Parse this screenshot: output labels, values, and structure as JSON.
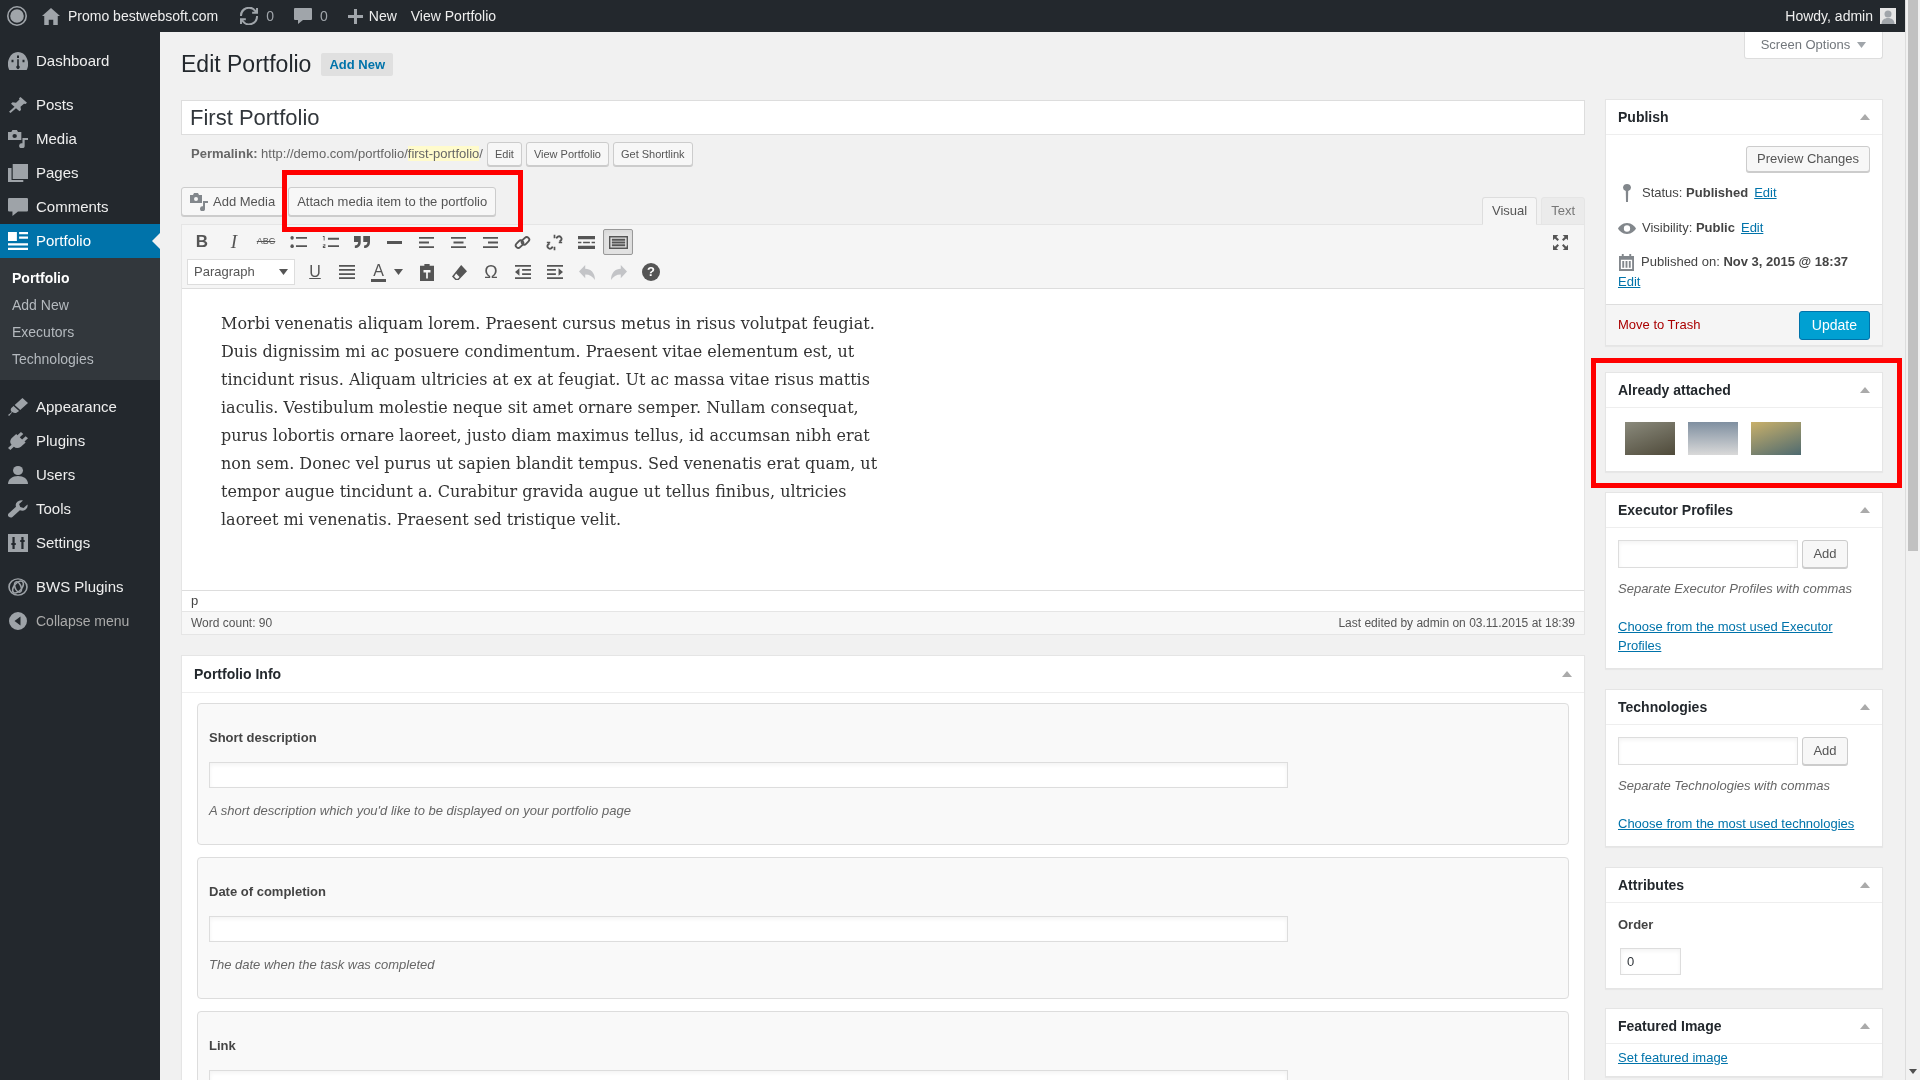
{
  "admin_bar": {
    "site_name": "Promo bestwebsoft.com",
    "updates": "0",
    "comments": "0",
    "new_label": "New",
    "view_label": "View Portfolio",
    "greeting": "Howdy, admin"
  },
  "sidebar": {
    "sections": [
      {
        "items": [
          {
            "kind": "dashboard",
            "label": "Dashboard",
            "selected": false
          }
        ]
      },
      {
        "items": [
          {
            "kind": "posts",
            "label": "Posts",
            "selected": false
          },
          {
            "kind": "media",
            "label": "Media",
            "selected": false
          },
          {
            "kind": "pages",
            "label": "Pages",
            "selected": false
          },
          {
            "kind": "comments",
            "label": "Comments",
            "selected": false
          },
          {
            "kind": "portfolio",
            "label": "Portfolio",
            "selected": true,
            "children": [
              {
                "label": "Portfolio",
                "selected": true
              },
              {
                "label": "Add New",
                "selected": false
              },
              {
                "label": "Executors",
                "selected": false
              },
              {
                "label": "Technologies",
                "selected": false
              }
            ]
          }
        ]
      },
      {
        "items": [
          {
            "kind": "appearance",
            "label": "Appearance",
            "selected": false
          },
          {
            "kind": "plugins",
            "label": "Plugins",
            "selected": false
          },
          {
            "kind": "users",
            "label": "Users",
            "selected": false
          },
          {
            "kind": "tools",
            "label": "Tools",
            "selected": false
          },
          {
            "kind": "settings",
            "label": "Settings",
            "selected": false
          }
        ]
      },
      {
        "items": [
          {
            "kind": "bws",
            "label": "BWS Plugins",
            "selected": false
          }
        ]
      }
    ],
    "collapse_label": "Collapse menu"
  },
  "screen_options": "Screen Options",
  "heading": {
    "title": "Edit Portfolio",
    "add_new": "Add New"
  },
  "post_title": "First Portfolio",
  "permalink": {
    "text": "**Permalink:** http://demo.com/portfolio/",
    "slug": "first-portfolio",
    "suffix": "/",
    "buttons": [
      "Edit",
      "View Portfolio",
      "Get Shortlink"
    ]
  },
  "media_buttons": [
    {
      "kind": "media",
      "label": "Add Media",
      "highlighted": false
    },
    {
      "kind": "attach",
      "label": "Attach media item to the portfolio",
      "highlighted": true
    }
  ],
  "editor_tabs": [
    {
      "label": "Visual",
      "selected": true
    },
    {
      "label": "Text",
      "selected": false
    }
  ],
  "toolbar": [
    [
      {
        "kind": "bold",
        "label": "B",
        "pressed": false,
        "disabled": false
      },
      {
        "kind": "italic",
        "label": "I",
        "pressed": false,
        "disabled": false
      },
      {
        "kind": "strike",
        "label": "ABC",
        "pressed": false,
        "disabled": false
      },
      {
        "kind": "bullets",
        "pressed": false,
        "disabled": false
      },
      {
        "kind": "numbers",
        "pressed": false,
        "disabled": false
      },
      {
        "kind": "quote",
        "pressed": false,
        "disabled": false
      },
      {
        "kind": "rule",
        "pressed": false,
        "disabled": false
      },
      {
        "kind": "alignleft",
        "pressed": false,
        "disabled": false
      },
      {
        "kind": "aligncenter",
        "pressed": false,
        "disabled": false
      },
      {
        "kind": "alignright",
        "pressed": false,
        "disabled": false
      },
      {
        "kind": "link",
        "pressed": false,
        "disabled": false
      },
      {
        "kind": "unlink",
        "pressed": false,
        "disabled": false
      },
      {
        "kind": "more",
        "pressed": false,
        "disabled": false
      },
      {
        "kind": "toggle",
        "pressed": true,
        "disabled": false
      },
      {
        "kind": "fullscreen",
        "pressed": false,
        "disabled": false
      }
    ],
    [
      {
        "kind": "format",
        "label": "Paragraph",
        "pressed": false,
        "disabled": false
      },
      {
        "kind": "underline",
        "label": "U",
        "pressed": false,
        "disabled": false
      },
      {
        "kind": "justify",
        "pressed": false,
        "disabled": false
      },
      {
        "kind": "color",
        "label": "A",
        "pressed": false,
        "disabled": false
      },
      {
        "kind": "paste",
        "pressed": false,
        "disabled": false
      },
      {
        "kind": "eraser",
        "pressed": false,
        "disabled": false
      },
      {
        "kind": "omega",
        "label": "Ω",
        "pressed": false,
        "disabled": false
      },
      {
        "kind": "outdent",
        "pressed": false,
        "disabled": false
      },
      {
        "kind": "indent",
        "pressed": false,
        "disabled": false
      },
      {
        "kind": "undo",
        "pressed": false,
        "disabled": true
      },
      {
        "kind": "redo",
        "pressed": false,
        "disabled": true
      },
      {
        "kind": "help",
        "label": "?",
        "pressed": false,
        "disabled": false
      }
    ]
  ],
  "content": "Morbi venenatis aliquam lorem. Praesent cursus metus in risus volutpat feugiat. Duis dignissim mi ac posuere condimentum. Praesent vitae elementum est, ut tincidunt risus. Aliquam ultricies at ex at feugiat. Ut ac massa vitae risus mattis iaculis. Vestibulum molestie neque sit amet ornare semper. Nullam consequat, purus lobortis ornare laoreet, justo diam maximus tellus, id accumsan nibh erat non sem. Donec vel purus ut sapien blandit tempus. Sed venenatis erat quam, ut tempor augue tincidunt a. Curabitur gravida augue ut tellus finibus, ultricies laoreet mi venenatis. Praesent sed tristique velit.",
  "path": "p",
  "word_count": "Word count: 90",
  "last_edited": "Last edited by admin on 03.11.2015 at 18:39",
  "portfolio_info": {
    "title": "Portfolio Info",
    "fields": [
      {
        "label": "Short description",
        "hint": "A short description which you'd like to be displayed on your portfolio page"
      },
      {
        "label": "Date of completion",
        "hint": "The date when the task was completed"
      },
      {
        "label": "Link"
      }
    ]
  },
  "publish": {
    "title": "Publish",
    "preview": "Preview Changes",
    "rows": [
      {
        "kind": "status",
        "text": "Status: **Published**",
        "link": "Edit"
      },
      {
        "kind": "visibility",
        "text": "Visibility: **Public**",
        "link": "Edit"
      },
      {
        "kind": "date",
        "text": "Published on: **Nov 3, 2015 @ 18:37**",
        "link": "Edit"
      }
    ],
    "trash": "Move to Trash",
    "update": "Update"
  },
  "already_attached": {
    "title": "Already attached",
    "highlighted": true,
    "thumbnails": [
      {
        "kind": "photo"
      },
      {
        "kind": "photo"
      },
      {
        "kind": "photo"
      }
    ]
  },
  "taxonomy_boxes": [
    {
      "title": "Executor Profiles",
      "add": "Add",
      "hint": "Separate Executor Profiles with commas",
      "link": "Choose from the most used Executor Profiles"
    },
    {
      "title": "Technologies",
      "add": "Add",
      "hint": "Separate Technologies with commas",
      "link": "Choose from the most used technologies"
    }
  ],
  "attributes": {
    "title": "Attributes",
    "order_label": "Order",
    "order_value": "0"
  },
  "featured_image": {
    "title": "Featured Image",
    "link": "Set featured image"
  }
}
